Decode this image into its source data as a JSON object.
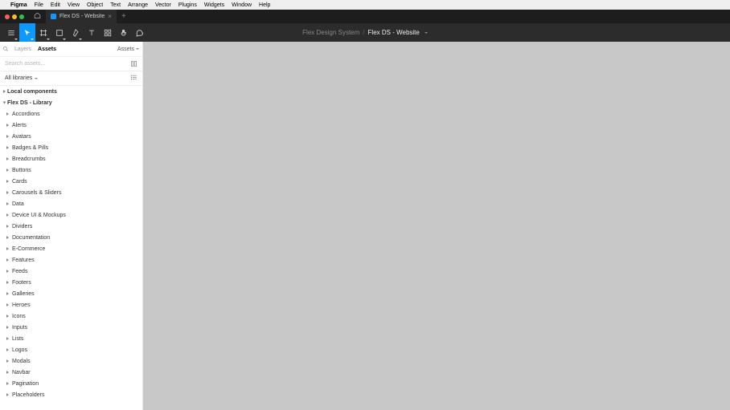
{
  "menubar": {
    "app": "Figma",
    "items": [
      "File",
      "Edit",
      "View",
      "Object",
      "Text",
      "Arrange",
      "Vector",
      "Plugins",
      "Widgets",
      "Window",
      "Help"
    ]
  },
  "tab": {
    "title": "Flex DS - Website"
  },
  "breadcrumb": {
    "parent": "Flex Design System",
    "current": "Flex DS - Website"
  },
  "panel": {
    "tabs": {
      "layers": "Layers",
      "assets": "Assets",
      "assets_dd": "Assets"
    },
    "search_placeholder": "Search assets...",
    "library_filter": "All libraries"
  },
  "tree": {
    "sections": [
      {
        "label": "Local components",
        "expanded": false
      },
      {
        "label": "Flex DS - Library",
        "expanded": true,
        "items": [
          "Accordions",
          "Alerts",
          "Avatars",
          "Badges & Pills",
          "Breadcrumbs",
          "Buttons",
          "Cards",
          "Carousels & Sliders",
          "Data",
          "Device UI & Mockups",
          "Dividers",
          "Documentation",
          "E-Commerce",
          "Features",
          "Feeds",
          "Footers",
          "Galleries",
          "Heroes",
          "Icons",
          "Inputs",
          "Lists",
          "Logos",
          "Modals",
          "Navbar",
          "Pagination",
          "Placeholders"
        ]
      }
    ]
  }
}
